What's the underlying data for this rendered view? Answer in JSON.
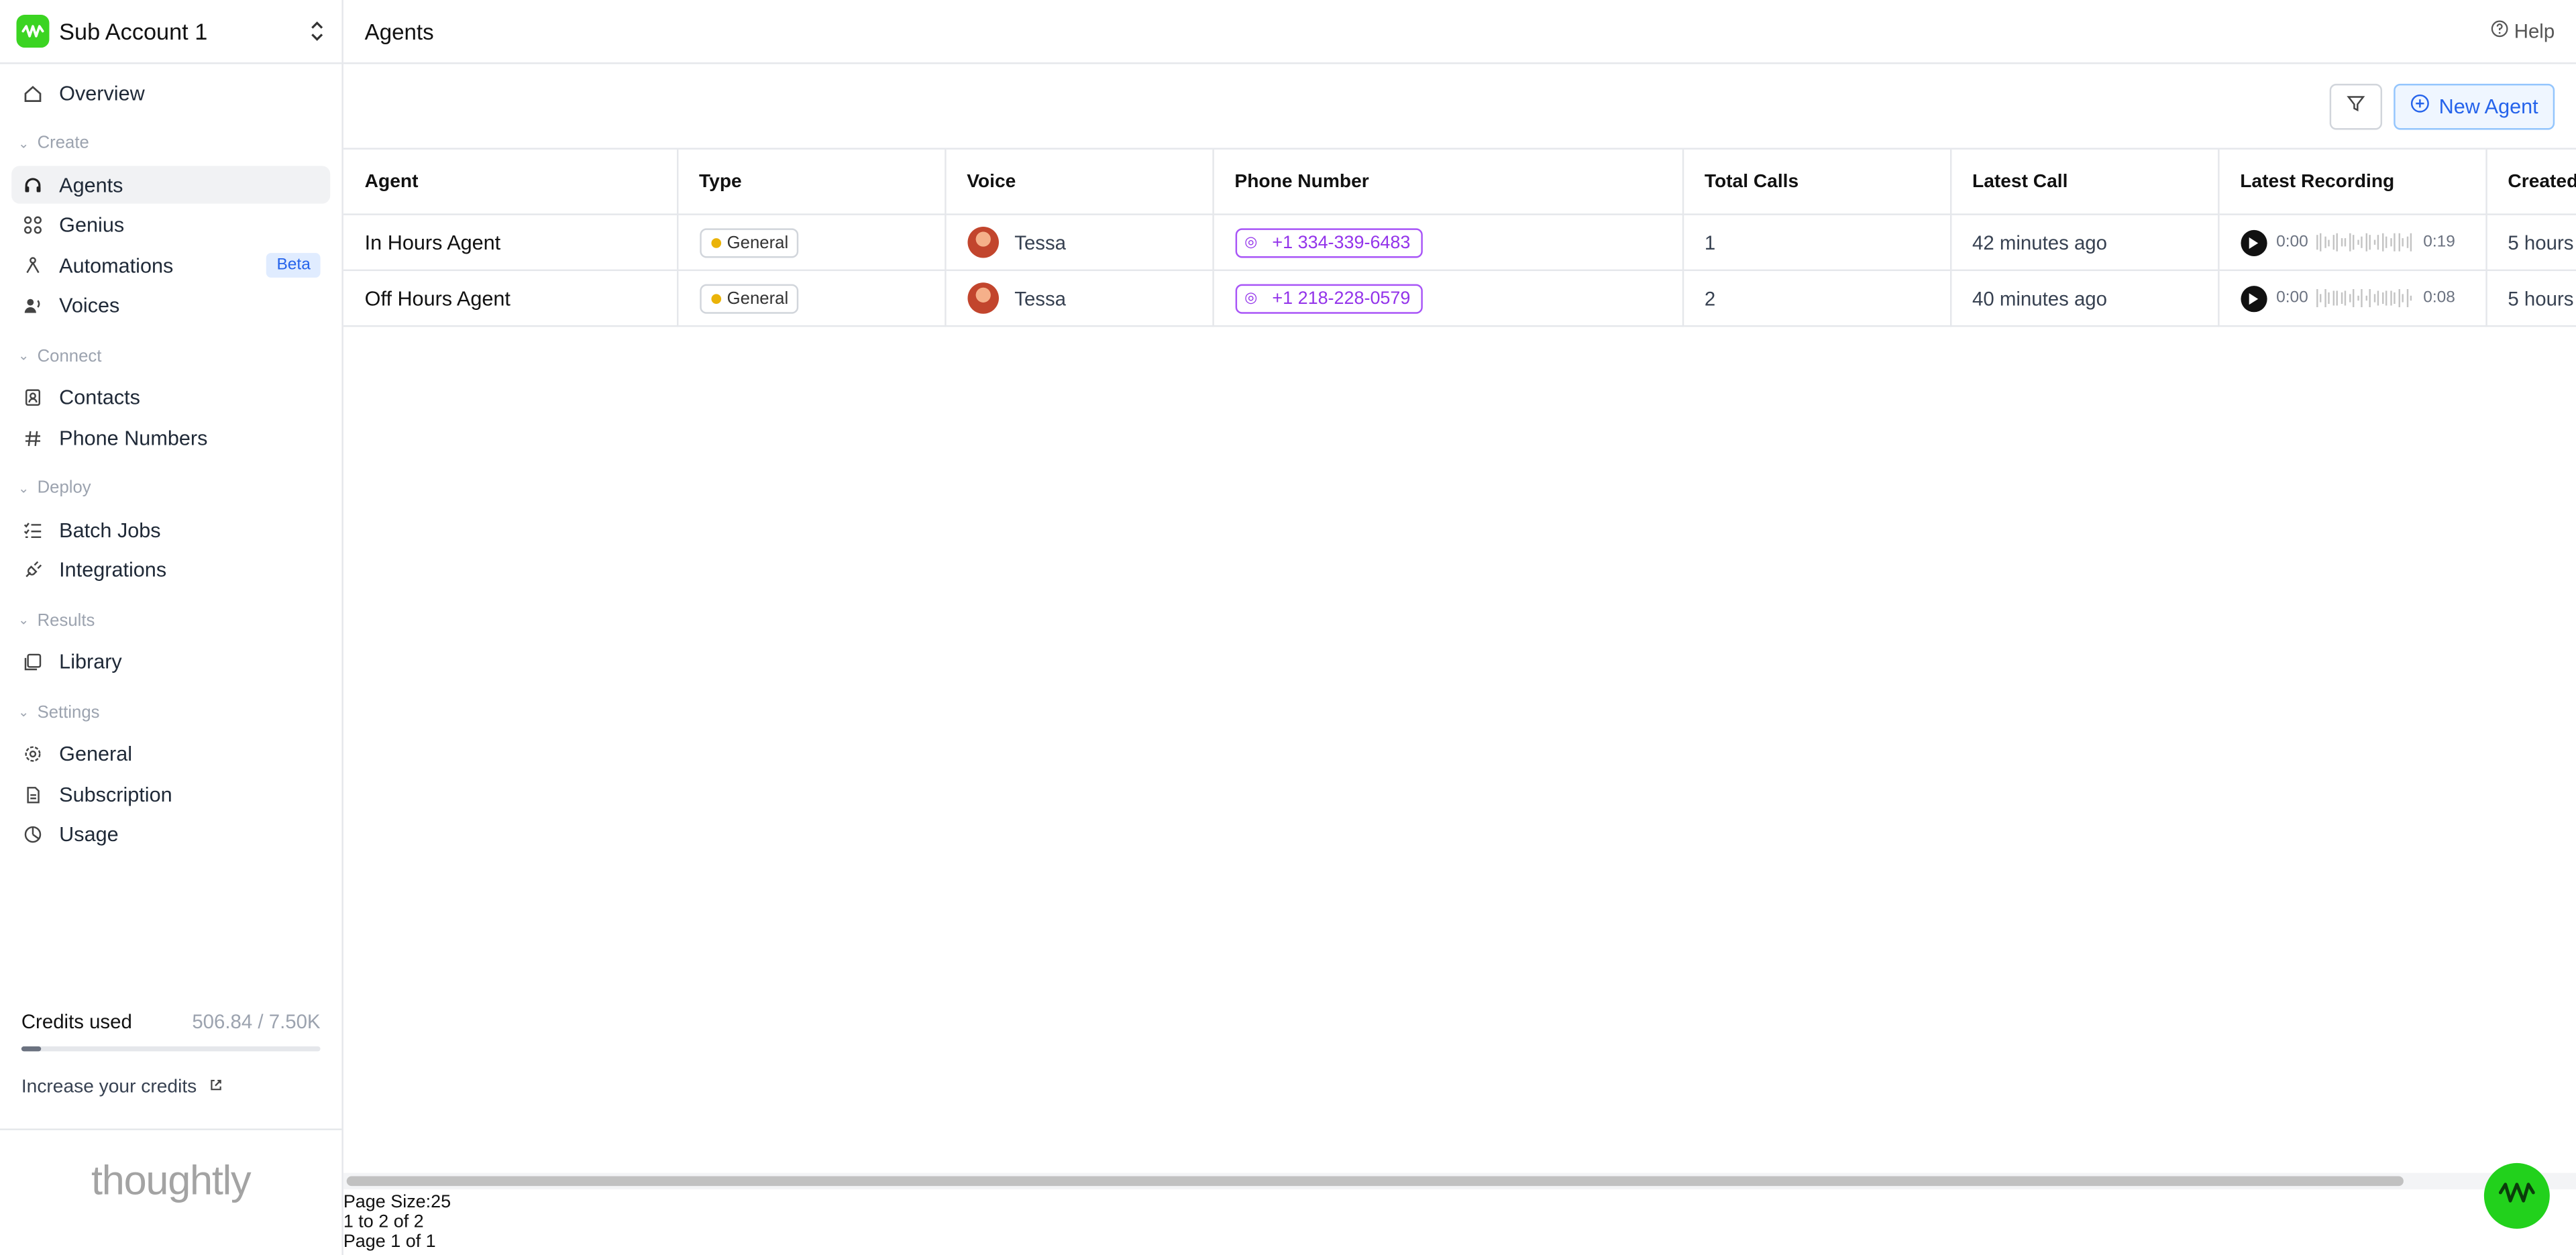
{
  "account": {
    "name": "Sub Account 1"
  },
  "sidebar": {
    "overview": "Overview",
    "groups": {
      "create": "Create",
      "connect": "Connect",
      "deploy": "Deploy",
      "results": "Results",
      "settings": "Settings"
    },
    "items": {
      "agents": "Agents",
      "genius": "Genius",
      "automations": "Automations",
      "automations_badge": "Beta",
      "voices": "Voices",
      "contacts": "Contacts",
      "phone_numbers": "Phone Numbers",
      "batch_jobs": "Batch Jobs",
      "integrations": "Integrations",
      "library": "Library",
      "general": "General",
      "subscription": "Subscription",
      "usage": "Usage"
    },
    "credits": {
      "label": "Credits used",
      "value": "506.84 / 7.50K",
      "fraction": 0.0676,
      "increase": "Increase your credits"
    },
    "brand": "thoughtly"
  },
  "header": {
    "title": "Agents",
    "help": "Help"
  },
  "toolbar": {
    "new_agent": "New Agent"
  },
  "table": {
    "columns": [
      "Agent",
      "Type",
      "Voice",
      "Phone Number",
      "Total Calls",
      "Latest Call",
      "Latest Recording",
      "Created"
    ],
    "rows": [
      {
        "agent": "In Hours Agent",
        "type": "General",
        "voice": "Tessa",
        "phone": "+1 334-339-6483",
        "total_calls": "1",
        "latest_call": "42 minutes ago",
        "rec_start": "0:00",
        "rec_end": "0:19",
        "created": "5 hours"
      },
      {
        "agent": "Off Hours Agent",
        "type": "General",
        "voice": "Tessa",
        "phone": "+1 218-228-0579",
        "total_calls": "2",
        "latest_call": "40 minutes ago",
        "rec_start": "0:00",
        "rec_end": "0:08",
        "created": "5 hours"
      }
    ]
  },
  "pagination": {
    "page_size": "Page Size:25",
    "range": "1 to 2 of 2",
    "page": "Page 1 of 1"
  },
  "colors": {
    "brand_green": "#22d11c",
    "accent_blue": "#2563eb",
    "phone_purple": "#9333ea"
  },
  "icons": [
    "home-icon",
    "headset-icon",
    "grid-icon",
    "workflow-icon",
    "voices-icon",
    "contacts-icon",
    "hash-icon",
    "checklist-icon",
    "plug-icon",
    "library-icon",
    "gear-icon",
    "document-icon",
    "pie-icon",
    "filter-icon",
    "plus-circle-icon",
    "help-icon",
    "external-link-icon",
    "play-icon"
  ]
}
